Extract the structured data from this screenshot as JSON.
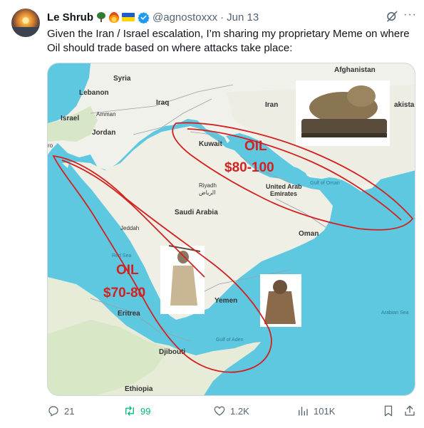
{
  "author": {
    "display_name": "Le Shrub",
    "handle": "@agnostoxxx",
    "separator": "·",
    "date": "Jun 13",
    "badges": [
      "tree-emoji",
      "fire-emoji",
      "ukraine-flag-emoji",
      "verified-badge"
    ]
  },
  "tweet": {
    "text": "Given the Iran / Israel escalation, I’m sharing my proprietary Meme on where Oil should trade based on where attacks take place:"
  },
  "map": {
    "labels": {
      "afghanistan": "Afghanistan",
      "syria": "Syria",
      "lebanon": "Lebanon",
      "iraq": "Iraq",
      "iran": "Iran",
      "pakistan": "akistan",
      "israel": "Israel",
      "amman": "Amman",
      "jordan": "Jordan",
      "ro": "ro",
      "kuwait": "Kuwait",
      "riyadh": "Riyadh",
      "riyadh_ar": "الرياض",
      "uae_1": "United Arab",
      "uae_2": "Emirates",
      "gulf_oman": "Gulf of Oman",
      "saudi": "Saudi Arabia",
      "jeddah": "Jeddah",
      "oman": "Oman",
      "red_sea": "Red Sea",
      "yemen": "Yemen",
      "eritrea": "Eritrea",
      "arabian_sea": "Arabian Sea",
      "gulf_aden": "Gulf of Aden",
      "djibouti": "Djibouti",
      "ethiopia": "Ethiopia"
    },
    "annotations": {
      "upper_oil": "OIL",
      "upper_price": "$80-100",
      "lower_oil": "OIL",
      "lower_price": "$70-80"
    },
    "annotation_color": "#d3211f"
  },
  "actions": {
    "replies": "21",
    "retweets": "99",
    "likes": "1.2K",
    "views": "101K"
  },
  "colors": {
    "retweet_active": "#00ba7c",
    "muted": "#536471",
    "verified": "#1d9bf0",
    "sea": "#5ec8e0",
    "land": "#f1f1ec"
  }
}
